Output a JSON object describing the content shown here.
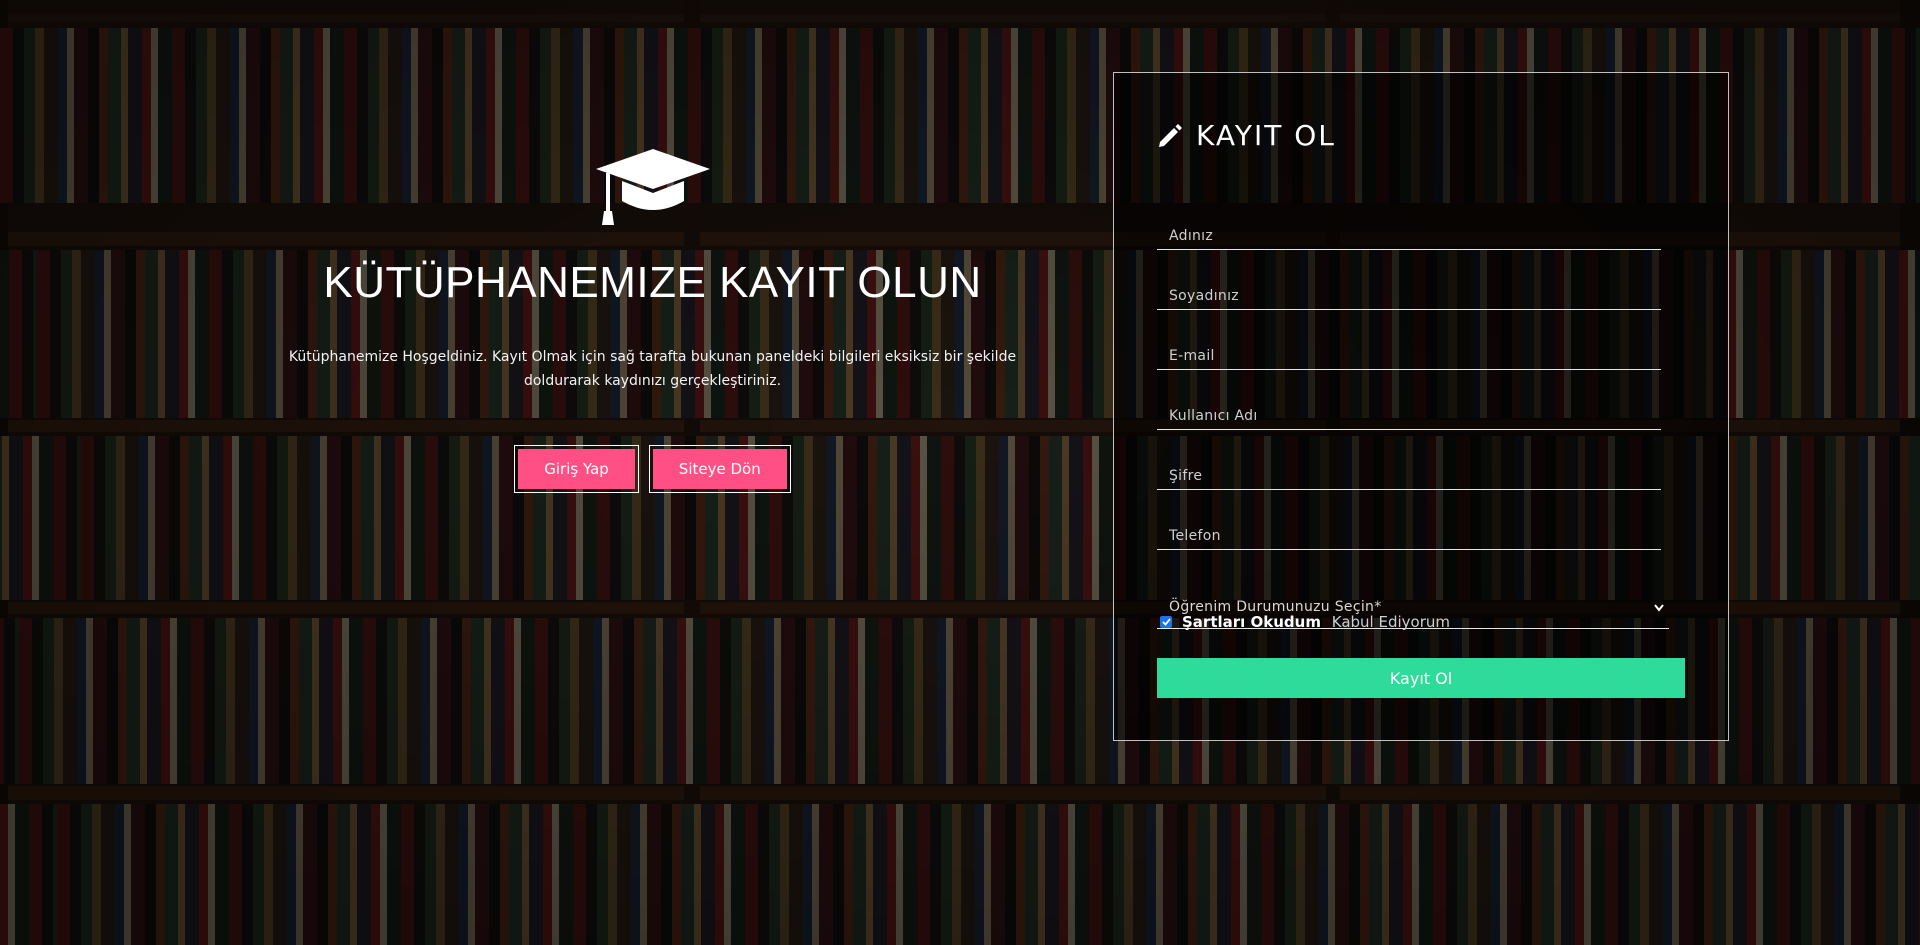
{
  "hero": {
    "title": "KÜTÜPHANEMIZE KAYIT OLUN",
    "description": "Kütüphanemize Hoşgeldiniz. Kayıt Olmak için sağ tarafta bukunan paneldeki bilgileri eksiksiz bir şekilde doldurarak kaydınızı gerçekleştiriniz.",
    "buttons": {
      "login": "Giriş Yap",
      "back": "Siteye Dön"
    },
    "icon": "graduation-cap-icon"
  },
  "register": {
    "title": "KAYIT OL",
    "icon": "pencil-icon",
    "fields": {
      "first_name": "Adınız",
      "last_name": "Soyadınız",
      "email": "E-mail",
      "username": "Kullanıcı Adı",
      "password": "Şifre",
      "phone": "Telefon"
    },
    "education_select": "Öğrenim Durumunuzu Seçin*",
    "terms": {
      "checked": true,
      "strong": "Şartları Okudum",
      "light": "Kabul Ediyorum"
    },
    "submit": "Kayıt Ol"
  },
  "colors": {
    "accent_pink": "#ff4f84",
    "accent_green": "#2edb9a",
    "checkbox_blue": "#1a73e8"
  }
}
